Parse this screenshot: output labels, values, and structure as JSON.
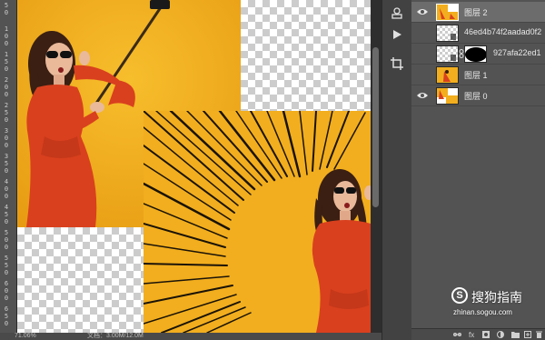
{
  "ruler": {
    "labels": [
      "5\n0",
      "1\n0\n0",
      "1\n5\n0",
      "2\n0\n0",
      "2\n5\n0",
      "3\n0\n0",
      "3\n5\n0",
      "4\n0\n0",
      "4\n5\n0",
      "5\n0\n0",
      "5\n5\n0",
      "6\n0\n0",
      "6\n5\n0"
    ]
  },
  "statusbar": {
    "zoom": "71.06%",
    "doc": "文档：3.00M/12.0M"
  },
  "toolstrip": {
    "icons": [
      "properties-icon",
      "play-icon",
      "crop-icon"
    ]
  },
  "layers": {
    "rows": [
      {
        "name": "图层 2",
        "visible": true,
        "selected": true
      },
      {
        "name": "46ed4b74f2aadad0f2",
        "visible": false,
        "selected": false
      },
      {
        "name": "927afa22ed1",
        "visible": false,
        "selected": false,
        "has_mask": true
      },
      {
        "name": "图层 1",
        "visible": false,
        "selected": false
      },
      {
        "name": "图层 0",
        "visible": true,
        "selected": false
      }
    ],
    "footer_icons": [
      "link-icon",
      "fx-icon",
      "mask-icon",
      "adjustment-icon",
      "folder-icon",
      "new-layer-icon",
      "trash-icon"
    ],
    "footer_fx": "fx"
  },
  "watermark": {
    "logo": "S",
    "title": "搜狗指南",
    "subtitle": "zhinan.sogou.com"
  },
  "colors": {
    "photo_yellow": "#F2AE1E",
    "dress_red": "#D9401E",
    "panel_bg": "#535353",
    "selected_row": "#6C6C6C"
  }
}
